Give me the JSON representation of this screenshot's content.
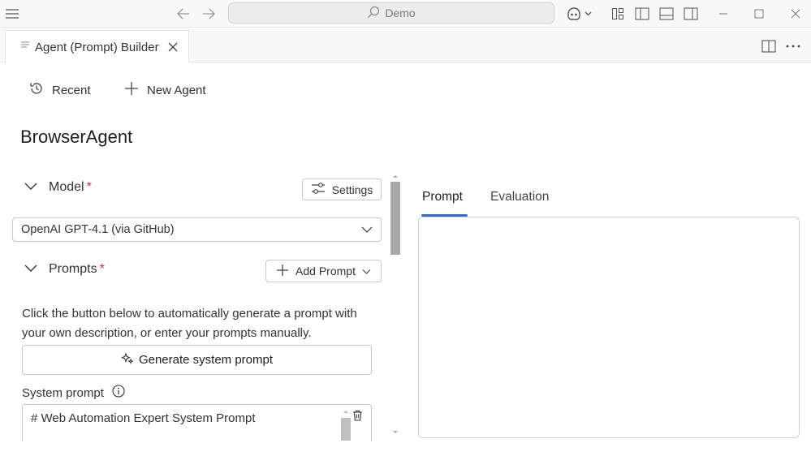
{
  "titlebar": {
    "search_text": "Demo"
  },
  "tab": {
    "label": "Agent (Prompt) Builder"
  },
  "toolbar": {
    "recent_label": "Recent",
    "new_agent_label": "New Agent"
  },
  "agent": {
    "name": "BrowserAgent"
  },
  "model_section": {
    "label": "Model",
    "required_mark": "*",
    "settings_label": "Settings",
    "selected_model": "OpenAI GPT-4.1 (via GitHub)"
  },
  "prompts_section": {
    "label": "Prompts",
    "required_mark": "*",
    "add_prompt_label": "Add Prompt",
    "helper_text": "Click the button below to automatically generate a prompt with your own description, or enter your prompts manually.",
    "generate_label": "Generate system prompt",
    "system_prompt_label": "System prompt",
    "system_prompt_value": "# Web Automation Expert System Prompt"
  },
  "right_panel": {
    "tabs": [
      {
        "label": "Prompt",
        "active": true
      },
      {
        "label": "Evaluation",
        "active": false
      }
    ]
  },
  "colors": {
    "accent": "#3a6fb6",
    "required": "#c4314b"
  }
}
